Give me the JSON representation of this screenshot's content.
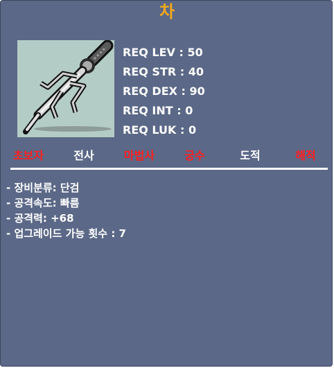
{
  "item": {
    "name": "차",
    "image": "dagger-icon"
  },
  "requirements": [
    {
      "label": "REQ LEV",
      "value": "50"
    },
    {
      "label": "REQ STR",
      "value": "40"
    },
    {
      "label": "REQ DEX",
      "value": "90"
    },
    {
      "label": "REQ INT",
      "value": "0"
    },
    {
      "label": "REQ LUK",
      "value": "0"
    }
  ],
  "jobs": [
    {
      "name": "초보자",
      "usable": false
    },
    {
      "name": "전사",
      "usable": true
    },
    {
      "name": "마법사",
      "usable": false
    },
    {
      "name": "궁수",
      "usable": false
    },
    {
      "name": "도적",
      "usable": true
    },
    {
      "name": "해적",
      "usable": false
    }
  ],
  "stats": [
    "- 장비분류: 단검",
    "- 공격속도: 빠름",
    "- 공격력: +68",
    "- 업그레이드 가능 횟수 : 7"
  ],
  "colors": {
    "background": "#5b6887",
    "item_name": "#f2a81d",
    "unusable_job": "#ff1e1e",
    "usable_job": "#ffffff",
    "image_background": "#b4ccc6"
  }
}
